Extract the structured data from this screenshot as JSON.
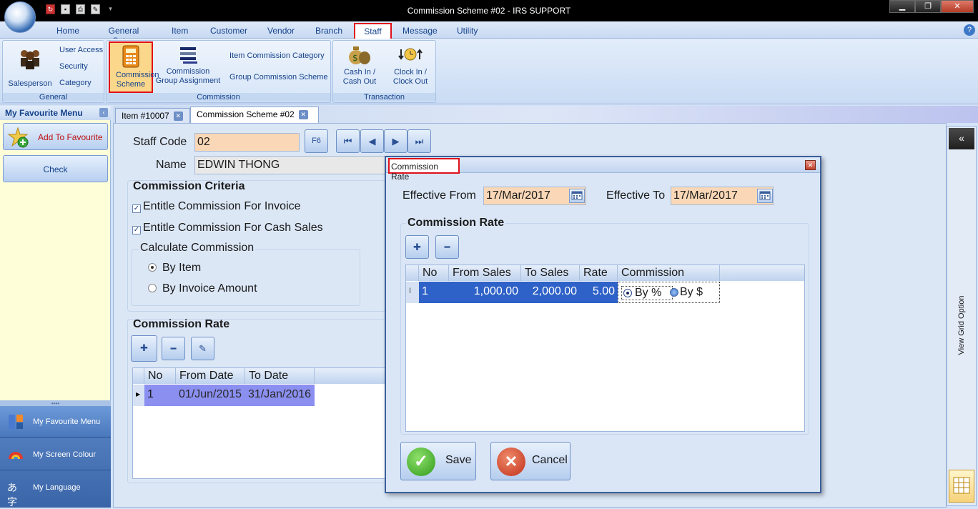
{
  "window": {
    "title": "Commission Scheme #02 - IRS SUPPORT"
  },
  "menu": {
    "tabs": [
      "Home",
      "General Setup",
      "Item",
      "Customer",
      "Vendor",
      "Branch",
      "Staff",
      "Message",
      "Utility"
    ],
    "active": "Staff"
  },
  "ribbon": {
    "general": {
      "label": "General",
      "salesperson": "Salesperson",
      "user_access": "User Access",
      "security": "Security",
      "category": "Category"
    },
    "commission": {
      "label": "Commission",
      "scheme": "Commission Scheme",
      "group_assignment": "Commission Group Assignment",
      "item_category": "Item Commission Category",
      "group_scheme": "Group Commission Scheme"
    },
    "transaction": {
      "label": "Transaction",
      "cash": "Cash In / Cash Out",
      "clock": "Clock In / Clock Out"
    }
  },
  "sidebar": {
    "title": "My Favourite Menu",
    "add_favourite": "Add To Favourite",
    "check": "Check",
    "nav": {
      "favourite": "My Favourite Menu",
      "screen_colour": "My Screen Colour",
      "language": "My Language"
    }
  },
  "doc_tabs": [
    "Item #10007",
    "Commission Scheme #02"
  ],
  "form": {
    "staff_code_label": "Staff Code",
    "staff_code": "02",
    "f6": "F6",
    "name_label": "Name",
    "name": "EDWIN THONG",
    "criteria_title": "Commission Criteria",
    "entitle_invoice": "Entitle Commission For Invoice",
    "entitle_cash_sales": "Entitle Commission For Cash Sales",
    "calc_title": "Calculate Commission",
    "by_item": "By Item",
    "by_invoice_amount": "By Invoice Amount",
    "rate_title": "Commission Rate",
    "grid": {
      "headers": [
        "No",
        "From Date",
        "To Date"
      ],
      "rows": [
        [
          "1",
          "01/Jun/2015",
          "31/Jan/2016"
        ]
      ]
    }
  },
  "right_panel": {
    "label": "View Grid Option"
  },
  "dialog": {
    "title": "Commission Rate",
    "effective_from_label": "Effective From",
    "effective_from": "17/Mar/2017",
    "effective_to_label": "Effective To",
    "effective_to": "17/Mar/2017",
    "section_title": "Commission Rate",
    "grid": {
      "headers": [
        "No",
        "From Sales",
        "To Sales",
        "Rate",
        "Commission"
      ],
      "rows": [
        {
          "no": "1",
          "from_sales": "1,000.00",
          "to_sales": "2,000.00",
          "rate": "5.00",
          "by_percent": "By %",
          "by_dollar": "By $",
          "selected": "By %"
        }
      ]
    },
    "save": "Save",
    "cancel": "Cancel"
  }
}
